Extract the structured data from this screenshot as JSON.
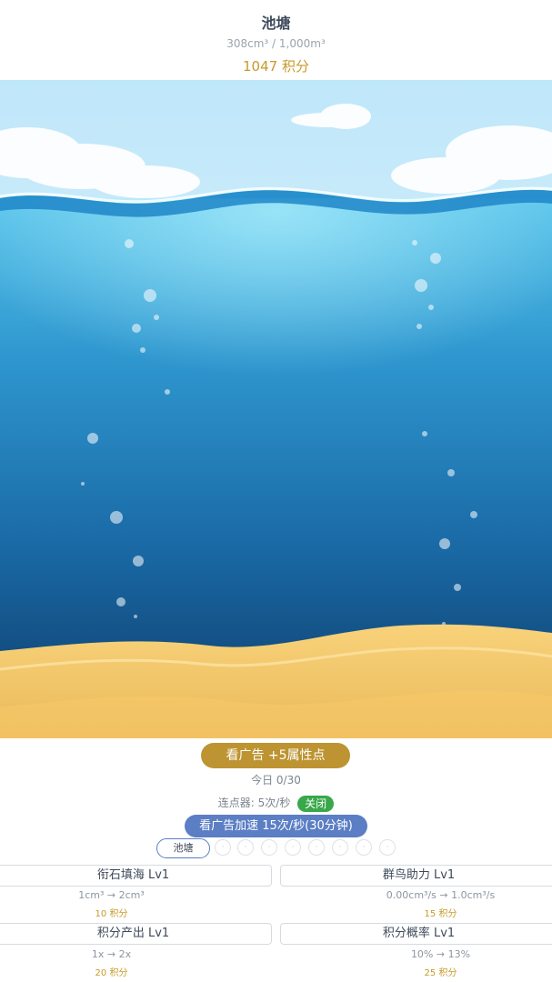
{
  "header": {
    "title": "池塘",
    "capacity": "308cm³ / 1,000m³",
    "points": "1047 积分"
  },
  "scene": {
    "sky_color": "#cfeefb",
    "water_top_color": "#3fb1e0",
    "water_bottom_color": "#14507f",
    "sand_color": "#f2c66a"
  },
  "controls": {
    "ad_button": "看广告 +5属性点",
    "today": "今日 0/30",
    "clicker_label": "连点器: 5次/秒",
    "clicker_toggle": "关闭",
    "speed_button": "看广告加速 15次/秒(30分钟)"
  },
  "tabs": {
    "active": "池塘",
    "dots": [
      "·",
      "·",
      "·",
      "·",
      "·",
      "·",
      "·",
      "·"
    ]
  },
  "upgrades": [
    {
      "name": "衔石填海 Lv1",
      "effect": "1cm³ → 2cm³",
      "cost": "10 积分"
    },
    {
      "name": "群鸟助力 Lv1",
      "effect": "0.00cm³/s → 1.0cm³/s",
      "cost": "15 积分"
    },
    {
      "name": "积分产出 Lv1",
      "effect": "1x → 2x",
      "cost": "20 积分"
    },
    {
      "name": "积分概率 Lv1",
      "effect": "10% → 13%",
      "cost": "25 积分"
    }
  ]
}
